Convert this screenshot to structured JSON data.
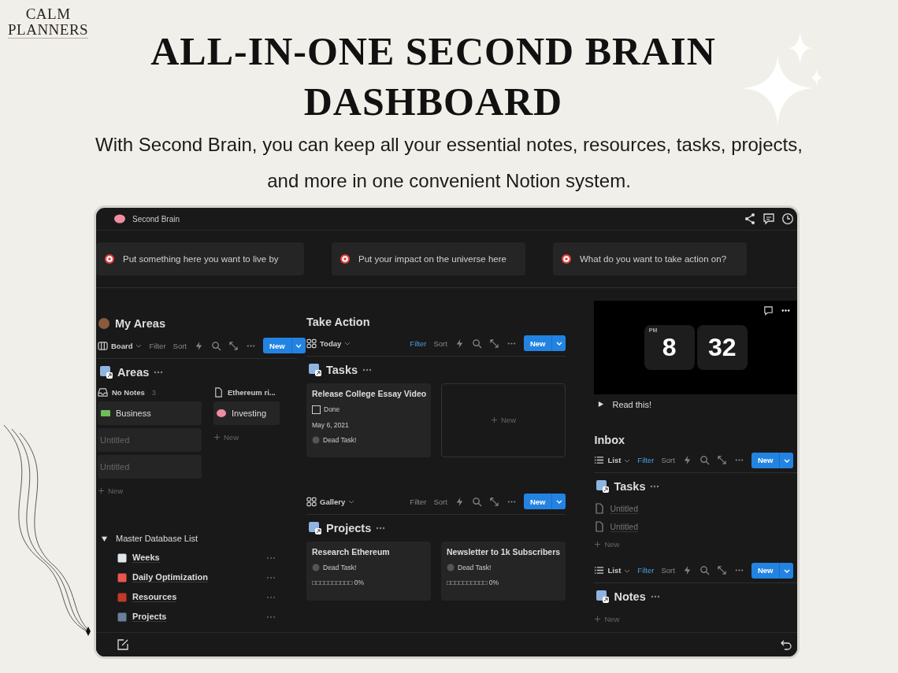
{
  "brand": {
    "line1": "CALM",
    "line2": "PLANNERS"
  },
  "headline": "ALL-IN-ONE SECOND BRAIN DASHBOARD",
  "subtitle": "With Second Brain, you can keep all your essential notes, resources, tasks, projects, and more in one convenient Notion system.",
  "app": {
    "title": "Second Brain",
    "callouts": [
      {
        "text": "Put something here you want to live by"
      },
      {
        "text": "Put your impact on the universe here"
      },
      {
        "text": "What do you want to take action on?"
      }
    ],
    "columns": [
      {
        "blocks": [
          {
            "kind": "heading",
            "text": "My Areas",
            "avatar": true
          },
          {
            "kind": "toolbar",
            "view": "Board",
            "filter": "Filter",
            "filter_active": false,
            "sort": "Sort",
            "new": "New"
          },
          {
            "kind": "db_title",
            "text": "Areas"
          },
          {
            "kind": "board",
            "groups": [
              {
                "name": "No Notes",
                "count": "3",
                "cards": [
                  {
                    "title": "Business",
                    "untitled": false
                  },
                  {
                    "title": "Untitled",
                    "untitled": true
                  },
                  {
                    "title": "Untitled",
                    "untitled": true
                  }
                ],
                "add": "New"
              },
              {
                "name": "Ethereum ri...",
                "cards": [
                  {
                    "title": "Investing",
                    "untitled": false
                  }
                ],
                "add": "New"
              }
            ]
          },
          {
            "kind": "toggle_list",
            "title": "Master Database List",
            "expanded": true,
            "items": [
              {
                "label": "Weeks"
              },
              {
                "label": "Daily Optimization"
              },
              {
                "label": "Resources"
              },
              {
                "label": "Projects"
              }
            ]
          }
        ]
      },
      {
        "blocks": [
          {
            "kind": "heading",
            "text": "Take Action",
            "avatar": false
          },
          {
            "kind": "toolbar",
            "view": "Today",
            "filter": "Filter",
            "filter_active": true,
            "sort": "Sort",
            "new": "New"
          },
          {
            "kind": "db_title",
            "text": "Tasks"
          },
          {
            "kind": "gallery",
            "cards": [
              {
                "title": "Release College Essay Video",
                "check_label": "Done",
                "checked": false,
                "date": "May 6, 2021",
                "status": "Dead Task!"
              }
            ],
            "new_card": "New"
          },
          {
            "kind": "toolbar",
            "view": "Gallery",
            "filter": "Filter",
            "filter_active": false,
            "sort": "Sort",
            "new": "New"
          },
          {
            "kind": "db_title",
            "text": "Projects"
          },
          {
            "kind": "gallery",
            "cards": [
              {
                "title": "Research Ethereum",
                "status": "Dead Task!",
                "progress": "□□□□□□□□□□ 0%"
              },
              {
                "title": "Newsletter to 1k Subscribers",
                "status": "Dead Task!",
                "progress": "□□□□□□□□□□ 0%"
              }
            ]
          }
        ]
      },
      {
        "blocks": [
          {
            "kind": "clock",
            "period": "PM",
            "hour": "8",
            "minute": "32"
          },
          {
            "kind": "toggle",
            "text": "Read this!",
            "expanded": false
          },
          {
            "kind": "heading",
            "text": "Inbox",
            "avatar": false
          },
          {
            "kind": "toolbar",
            "view": "List",
            "filter": "Filter",
            "filter_active": true,
            "sort": "Sort",
            "new": "New"
          },
          {
            "kind": "db_title",
            "text": "Tasks"
          },
          {
            "kind": "list",
            "rows": [
              {
                "title": "Untitled"
              },
              {
                "title": "Untitled"
              }
            ],
            "add": "New"
          },
          {
            "kind": "toolbar",
            "view": "List",
            "filter": "Filter",
            "filter_active": true,
            "sort": "Sort",
            "new": "New"
          },
          {
            "kind": "db_title",
            "text": "Notes"
          },
          {
            "kind": "list",
            "add": "New"
          }
        ]
      }
    ]
  }
}
